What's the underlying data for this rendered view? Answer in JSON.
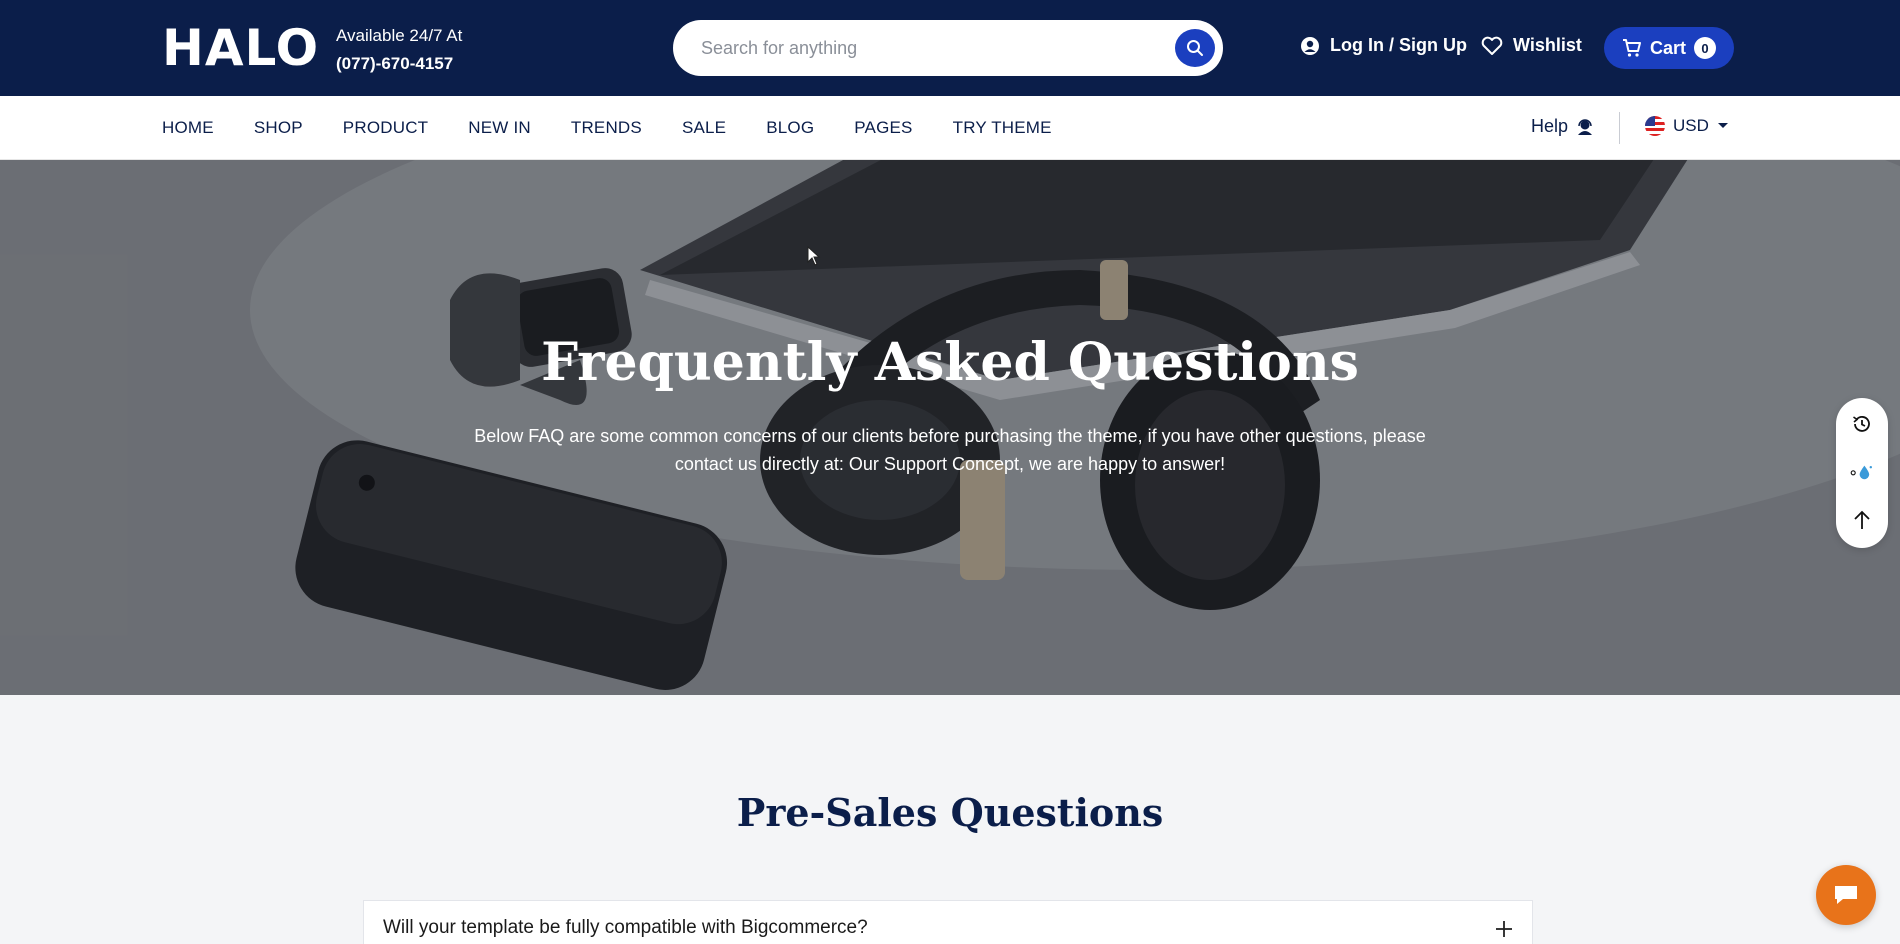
{
  "header": {
    "logo": "HALO",
    "availability": "Available 24/7 At",
    "phone": "(077)-670-4157",
    "search_placeholder": "Search for anything",
    "login_label": "Log In / Sign Up",
    "wishlist_label": "Wishlist",
    "cart_label": "Cart",
    "cart_count": "0"
  },
  "nav": {
    "items": [
      "HOME",
      "SHOP",
      "PRODUCT",
      "NEW IN",
      "TRENDS",
      "SALE",
      "BLOG",
      "PAGES",
      "TRY THEME"
    ],
    "help_label": "Help",
    "currency": "USD"
  },
  "hero": {
    "title": "Frequently Asked Questions",
    "subtitle": "Below FAQ are some common concerns of our clients before purchasing the theme, if you have other questions, please contact us directly at: Our Support Concept, we are happy to answer!"
  },
  "content": {
    "section_title": "Pre-Sales Questions",
    "faq": [
      {
        "question": "Will your template be fully compatible with Bigcommerce?"
      }
    ]
  },
  "side_tools": [
    "history-icon",
    "color-drop-icon",
    "arrow-up-icon"
  ],
  "colors": {
    "header_bg": "#0b1e4a",
    "accent": "#1b3fbf",
    "chat": "#e8731a"
  }
}
